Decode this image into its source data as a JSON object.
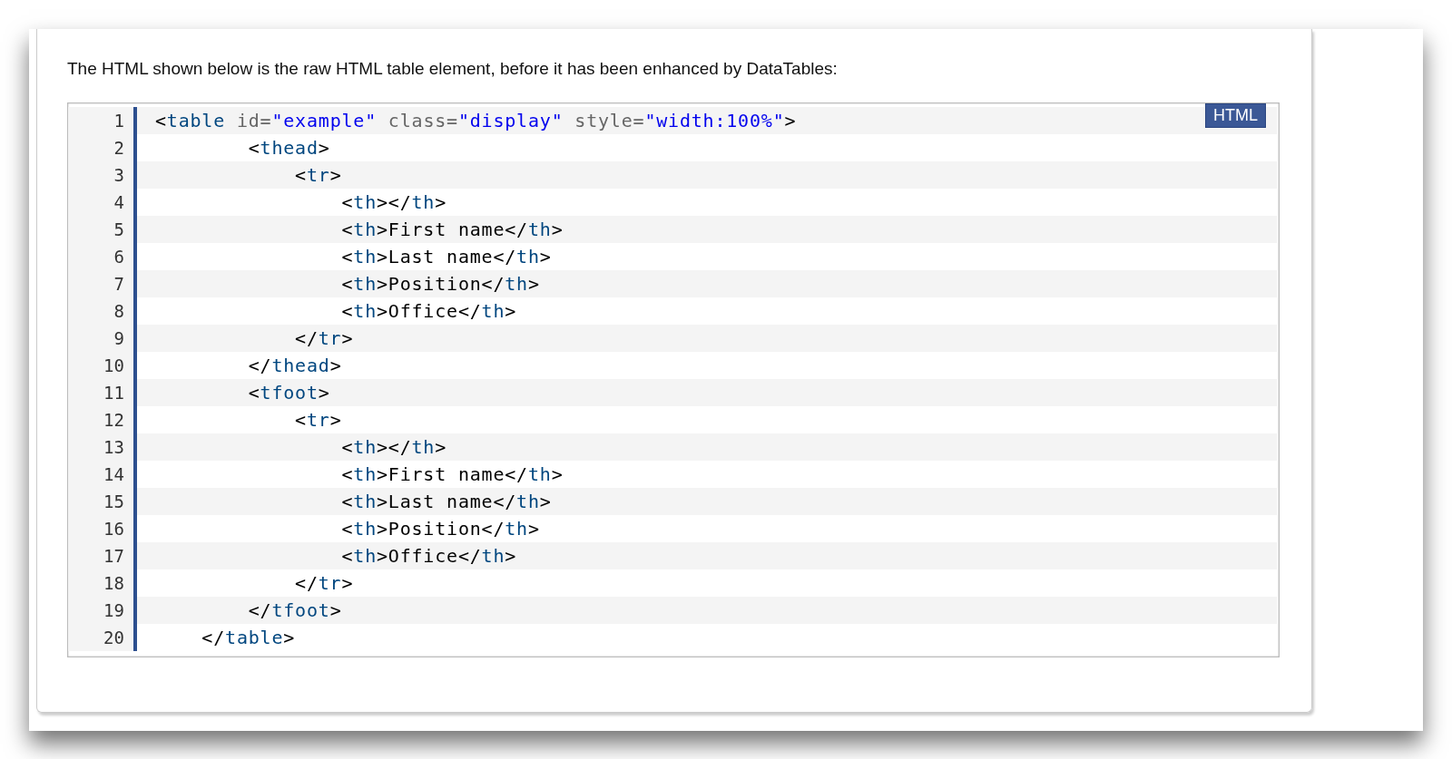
{
  "intro": "The HTML shown below is the raw HTML table element, before it has been enhanced by DataTables:",
  "code": {
    "language_badge": "HTML",
    "lines": [
      {
        "number": "1",
        "tokens": [
          {
            "kind": "punct",
            "text": "<"
          },
          {
            "kind": "tag",
            "text": "table"
          },
          {
            "kind": "attr",
            "text": " id="
          },
          {
            "kind": "string",
            "text": "\"example\""
          },
          {
            "kind": "attr",
            "text": " class="
          },
          {
            "kind": "string",
            "text": "\"display\""
          },
          {
            "kind": "attr",
            "text": " style="
          },
          {
            "kind": "string",
            "text": "\"width:100%\""
          },
          {
            "kind": "punct",
            "text": ">"
          }
        ]
      },
      {
        "number": "2",
        "tokens": [
          {
            "kind": "punct",
            "text": "        <"
          },
          {
            "kind": "tag",
            "text": "thead"
          },
          {
            "kind": "punct",
            "text": ">"
          }
        ]
      },
      {
        "number": "3",
        "tokens": [
          {
            "kind": "punct",
            "text": "            <"
          },
          {
            "kind": "tag",
            "text": "tr"
          },
          {
            "kind": "punct",
            "text": ">"
          }
        ]
      },
      {
        "number": "4",
        "tokens": [
          {
            "kind": "punct",
            "text": "                <"
          },
          {
            "kind": "tag",
            "text": "th"
          },
          {
            "kind": "punct",
            "text": "></"
          },
          {
            "kind": "tag",
            "text": "th"
          },
          {
            "kind": "punct",
            "text": ">"
          }
        ]
      },
      {
        "number": "5",
        "tokens": [
          {
            "kind": "punct",
            "text": "                <"
          },
          {
            "kind": "tag",
            "text": "th"
          },
          {
            "kind": "punct",
            "text": ">First name</"
          },
          {
            "kind": "tag",
            "text": "th"
          },
          {
            "kind": "punct",
            "text": ">"
          }
        ]
      },
      {
        "number": "6",
        "tokens": [
          {
            "kind": "punct",
            "text": "                <"
          },
          {
            "kind": "tag",
            "text": "th"
          },
          {
            "kind": "punct",
            "text": ">Last name</"
          },
          {
            "kind": "tag",
            "text": "th"
          },
          {
            "kind": "punct",
            "text": ">"
          }
        ]
      },
      {
        "number": "7",
        "tokens": [
          {
            "kind": "punct",
            "text": "                <"
          },
          {
            "kind": "tag",
            "text": "th"
          },
          {
            "kind": "punct",
            "text": ">Position</"
          },
          {
            "kind": "tag",
            "text": "th"
          },
          {
            "kind": "punct",
            "text": ">"
          }
        ]
      },
      {
        "number": "8",
        "tokens": [
          {
            "kind": "punct",
            "text": "                <"
          },
          {
            "kind": "tag",
            "text": "th"
          },
          {
            "kind": "punct",
            "text": ">Office</"
          },
          {
            "kind": "tag",
            "text": "th"
          },
          {
            "kind": "punct",
            "text": ">"
          }
        ]
      },
      {
        "number": "9",
        "tokens": [
          {
            "kind": "punct",
            "text": "            </"
          },
          {
            "kind": "tag",
            "text": "tr"
          },
          {
            "kind": "punct",
            "text": ">"
          }
        ]
      },
      {
        "number": "10",
        "tokens": [
          {
            "kind": "punct",
            "text": "        </"
          },
          {
            "kind": "tag",
            "text": "thead"
          },
          {
            "kind": "punct",
            "text": ">"
          }
        ]
      },
      {
        "number": "11",
        "tokens": [
          {
            "kind": "punct",
            "text": "        <"
          },
          {
            "kind": "tag",
            "text": "tfoot"
          },
          {
            "kind": "punct",
            "text": ">"
          }
        ]
      },
      {
        "number": "12",
        "tokens": [
          {
            "kind": "punct",
            "text": "            <"
          },
          {
            "kind": "tag",
            "text": "tr"
          },
          {
            "kind": "punct",
            "text": ">"
          }
        ]
      },
      {
        "number": "13",
        "tokens": [
          {
            "kind": "punct",
            "text": "                <"
          },
          {
            "kind": "tag",
            "text": "th"
          },
          {
            "kind": "punct",
            "text": "></"
          },
          {
            "kind": "tag",
            "text": "th"
          },
          {
            "kind": "punct",
            "text": ">"
          }
        ]
      },
      {
        "number": "14",
        "tokens": [
          {
            "kind": "punct",
            "text": "                <"
          },
          {
            "kind": "tag",
            "text": "th"
          },
          {
            "kind": "punct",
            "text": ">First name</"
          },
          {
            "kind": "tag",
            "text": "th"
          },
          {
            "kind": "punct",
            "text": ">"
          }
        ]
      },
      {
        "number": "15",
        "tokens": [
          {
            "kind": "punct",
            "text": "                <"
          },
          {
            "kind": "tag",
            "text": "th"
          },
          {
            "kind": "punct",
            "text": ">Last name</"
          },
          {
            "kind": "tag",
            "text": "th"
          },
          {
            "kind": "punct",
            "text": ">"
          }
        ]
      },
      {
        "number": "16",
        "tokens": [
          {
            "kind": "punct",
            "text": "                <"
          },
          {
            "kind": "tag",
            "text": "th"
          },
          {
            "kind": "punct",
            "text": ">Position</"
          },
          {
            "kind": "tag",
            "text": "th"
          },
          {
            "kind": "punct",
            "text": ">"
          }
        ]
      },
      {
        "number": "17",
        "tokens": [
          {
            "kind": "punct",
            "text": "                <"
          },
          {
            "kind": "tag",
            "text": "th"
          },
          {
            "kind": "punct",
            "text": ">Office</"
          },
          {
            "kind": "tag",
            "text": "th"
          },
          {
            "kind": "punct",
            "text": ">"
          }
        ]
      },
      {
        "number": "18",
        "tokens": [
          {
            "kind": "punct",
            "text": "            </"
          },
          {
            "kind": "tag",
            "text": "tr"
          },
          {
            "kind": "punct",
            "text": ">"
          }
        ]
      },
      {
        "number": "19",
        "tokens": [
          {
            "kind": "punct",
            "text": "        </"
          },
          {
            "kind": "tag",
            "text": "tfoot"
          },
          {
            "kind": "punct",
            "text": ">"
          }
        ]
      },
      {
        "number": "20",
        "tokens": [
          {
            "kind": "punct",
            "text": "    </"
          },
          {
            "kind": "tag",
            "text": "table"
          },
          {
            "kind": "punct",
            "text": ">"
          }
        ]
      }
    ]
  }
}
